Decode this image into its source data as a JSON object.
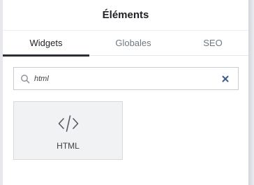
{
  "header": {
    "title": "Éléments"
  },
  "tabs": [
    {
      "label": "Widgets",
      "active": true
    },
    {
      "label": "Globales",
      "active": false
    },
    {
      "label": "SEO",
      "active": false
    }
  ],
  "search": {
    "value": "html",
    "placeholder": ""
  },
  "icons": {
    "search": "search-icon",
    "clear": "close-icon",
    "widget": "code-icon"
  },
  "widgets": [
    {
      "label": "HTML",
      "icon": "code-icon"
    }
  ],
  "colors": {
    "clear_icon": "#3b5e8c",
    "tab_indicator": "#2a2f35"
  }
}
